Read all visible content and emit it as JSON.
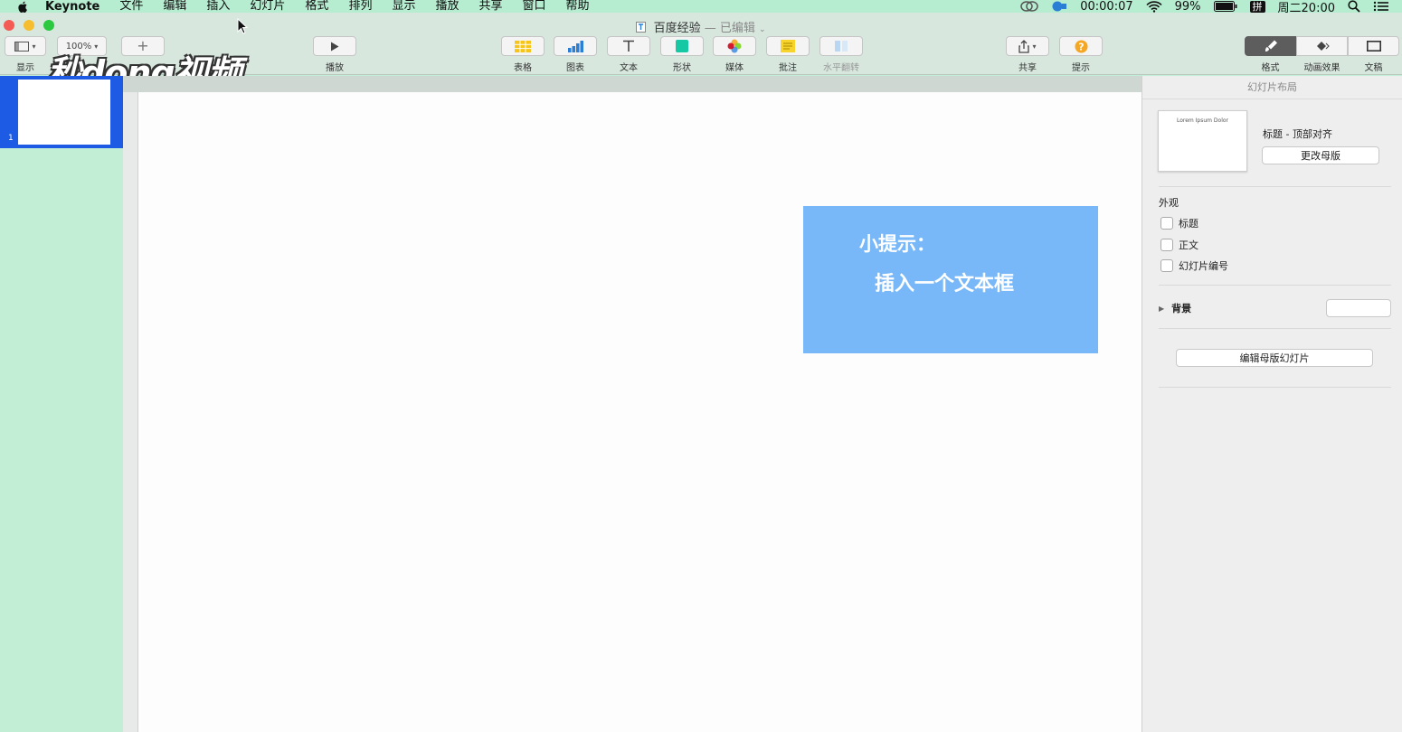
{
  "menubar": {
    "app_name": "Keynote",
    "items": [
      "文件",
      "编辑",
      "插入",
      "幻灯片",
      "格式",
      "排列",
      "显示",
      "播放",
      "共享",
      "窗口",
      "帮助"
    ],
    "recording_time": "00:00:07",
    "battery": "99%",
    "input_method": "拼",
    "clock": "周二20:00"
  },
  "titlebar": {
    "doc_name": "百度经验",
    "separator": "—",
    "status": "已编辑"
  },
  "toolbar": {
    "view_label": "显示",
    "zoom_value": "100%",
    "play_label": "播放",
    "table_label": "表格",
    "chart_label": "图表",
    "text_label": "文本",
    "shape_label": "形状",
    "media_label": "媒体",
    "comment_label": "批注",
    "flip_label": "水平翻转",
    "share_label": "共享",
    "tips_label": "提示",
    "format_label": "格式",
    "animate_label": "动画效果",
    "document_label": "文稿"
  },
  "watermark": "秒dong视频",
  "navigator": {
    "slide_number": "1"
  },
  "slide": {
    "tip_title": "小提示：",
    "tip_body": "插入一个文本框"
  },
  "inspector": {
    "header": "幻灯片布局",
    "preview_text": "Lorem Ipsum Dolor",
    "layout_name": "标题 - 顶部对齐",
    "change_master_button": "更改母版",
    "appearance_title": "外观",
    "checkbox_title": "标题",
    "checkbox_body": "正文",
    "checkbox_slide_number": "幻灯片编号",
    "background_label": "背景",
    "edit_master_button": "编辑母版幻灯片"
  },
  "colors": {
    "menubar_bg": "#b6ecd0",
    "selection_blue": "#1d5be4",
    "tip_box_blue": "#78b8f8",
    "active_tab": "#5d5d5d"
  }
}
